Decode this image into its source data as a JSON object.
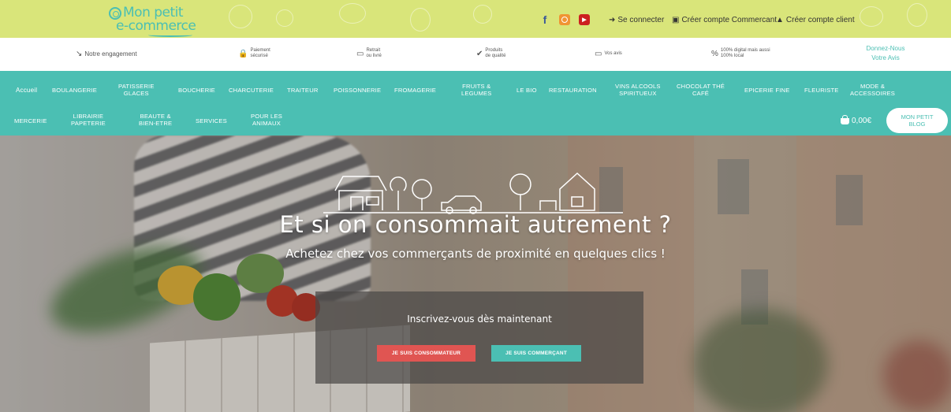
{
  "brand": {
    "logo_line1": "Mon petit",
    "logo_line2": "e-commerce",
    "accent": "#4bbfb3",
    "topbar_color": "#d9e57a"
  },
  "top_links": {
    "social": [
      "facebook-icon",
      "instagram-icon",
      "youtube-icon"
    ],
    "login": "Se connecter",
    "merchant_account": "Créer compte Commercant",
    "client_account": "Créer compte client"
  },
  "features": [
    {
      "icon": "arrow-curve-icon",
      "text": "Notre engagement"
    },
    {
      "icon": "lock-icon",
      "text": "Paiement\nsécurisé"
    },
    {
      "icon": "delivery-truck-icon",
      "text": "Retrait\nou livré"
    },
    {
      "icon": "checkmark-icon",
      "text": "Produits\nde qualité"
    },
    {
      "icon": "chat-bubble-icon",
      "text": "Vos avis"
    },
    {
      "icon": "percent-icon",
      "text": "100% digital mais aussi\n100% local"
    }
  ],
  "review_link": {
    "line1": "Donnez-Nous",
    "line2": "Votre Avis"
  },
  "nav": {
    "row1": [
      "Accueil",
      "BOULANGERIE",
      "PATISSERIE\nGLACES",
      "BOUCHERIE",
      "CHARCUTERIE",
      "TRAITEUR",
      "POISSONNERIE",
      "FROMAGERIE",
      "FRUITS &\nLEGUMES",
      "LE BIO",
      "RESTAURATION",
      "VINS ALCOOLS\nSPIRITUEUX",
      "CHOCOLAT THÉ\nCAFÉ",
      "EPICERIE FINE",
      "FLEURISTE",
      "MODE &\nACCESSOIRES"
    ],
    "row2": [
      "MERCERIE",
      "LIBRAIRIE\nPAPETERIE",
      "BEAUTE &\nBIEN-ETRE",
      "SERVICES",
      "POUR LES\nANIMAUX"
    ],
    "cart_total": "0,00€",
    "blog_button": "MON PETIT\nBLOG"
  },
  "hero": {
    "title": "Et si on consommait autrement ?",
    "subtitle": "Achetez chez vos commerçants de proximité en quelques clics !",
    "signup_prompt": "Inscrivez-vous dès maintenant",
    "consumer_button": "JE SUIS CONSOMMATEUR",
    "merchant_button": "JE SUIS COMMERÇANT",
    "consumer_color": "#e05552"
  }
}
